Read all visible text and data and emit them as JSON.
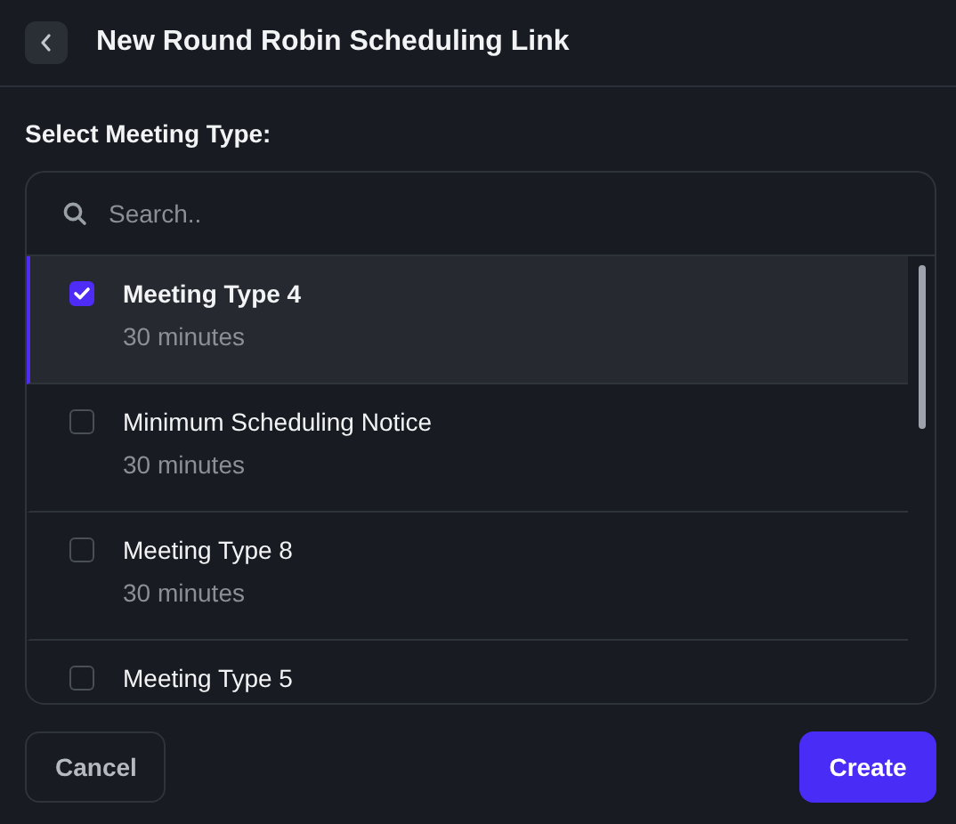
{
  "header": {
    "title": "New Round Robin Scheduling Link"
  },
  "section_label": "Select Meeting Type:",
  "search": {
    "placeholder": "Search.."
  },
  "meeting_types": [
    {
      "name": "Meeting Type 4",
      "duration": "30 minutes",
      "selected": true
    },
    {
      "name": "Minimum Scheduling Notice",
      "duration": "30 minutes",
      "selected": false
    },
    {
      "name": "Meeting Type 8",
      "duration": "30 minutes",
      "selected": false
    },
    {
      "name": "Meeting Type 5",
      "selected": false
    }
  ],
  "buttons": [
    {
      "label": "Cancel",
      "kind": "secondary"
    },
    {
      "label": "Create",
      "kind": "primary"
    }
  ]
}
